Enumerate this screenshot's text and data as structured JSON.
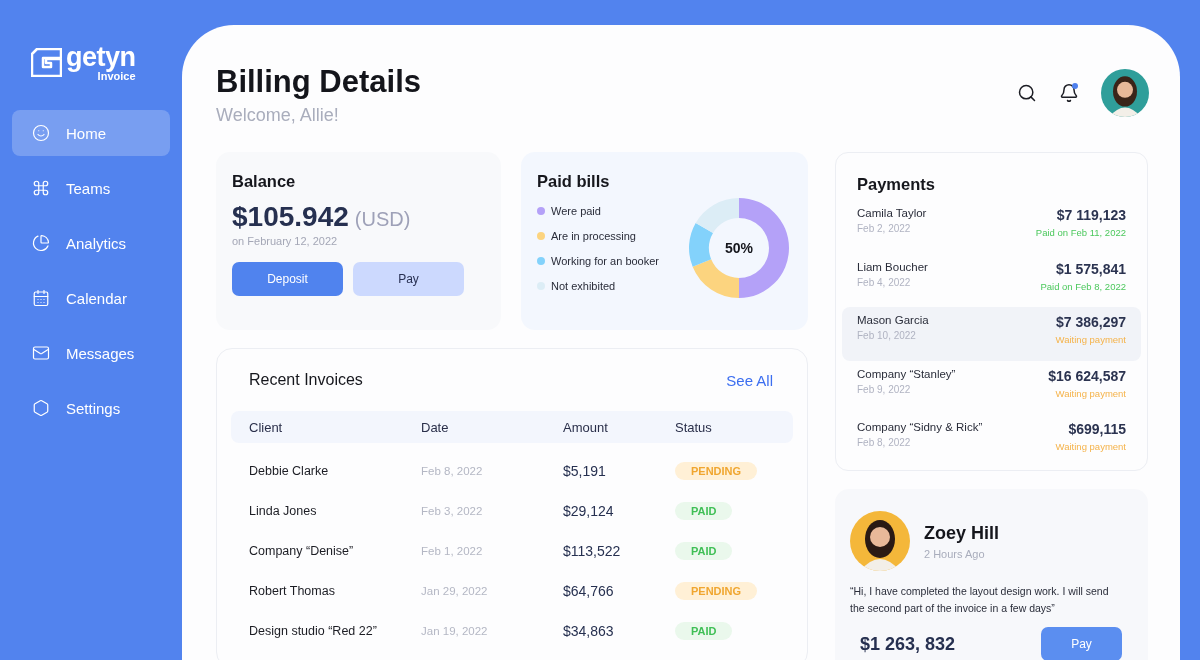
{
  "brand": {
    "name": "getyn",
    "sub": "Invoice"
  },
  "sidebar": {
    "items": [
      {
        "label": "Home",
        "selected": true
      },
      {
        "label": "Teams",
        "selected": false
      },
      {
        "label": "Analytics",
        "selected": false
      },
      {
        "label": "Calendar",
        "selected": false
      },
      {
        "label": "Messages",
        "selected": false
      },
      {
        "label": "Settings",
        "selected": false
      }
    ]
  },
  "header": {
    "title": "Billing Details",
    "subtitle": "Welcome, Allie!",
    "notification_badge": true
  },
  "balance": {
    "title": "Balance",
    "amount": "$105.942",
    "currency": "(USD)",
    "date": "on February 12, 2022",
    "buttons": [
      {
        "label": "Deposit",
        "kind": "primary"
      },
      {
        "label": "Pay",
        "kind": "secondary"
      }
    ]
  },
  "paid_bills": {
    "title": "Paid bills",
    "center_label": "50%",
    "legend": [
      {
        "label": "Were paid",
        "color": "#b4a1f8"
      },
      {
        "label": "Are in processing",
        "color": "#fcd47f"
      },
      {
        "label": "Working for an booker",
        "color": "#83d2fb"
      },
      {
        "label": "Not exhibited",
        "color": "#dcedf6"
      }
    ]
  },
  "invoices": {
    "title": "Recent Invoices",
    "link": "See All",
    "columns": [
      "Client",
      "Date",
      "Amount",
      "Status"
    ],
    "rows": [
      {
        "client": "Debbie Clarke",
        "date": "Feb 8, 2022",
        "amount": "$5,191",
        "status": "PENDING",
        "kind": "pending"
      },
      {
        "client": "Linda Jones",
        "date": "Feb 3, 2022",
        "amount": "$29,124",
        "status": "PAID",
        "kind": "paid"
      },
      {
        "client": "Company “Denise”",
        "date": "Feb 1, 2022",
        "amount": "$113,522",
        "status": "PAID",
        "kind": "paid"
      },
      {
        "client": "Robert Thomas",
        "date": "Jan 29, 2022",
        "amount": "$64,766",
        "status": "PENDING",
        "kind": "pending"
      },
      {
        "client": "Design studio “Red 22”",
        "date": "Jan 19, 2022",
        "amount": "$34,863",
        "status": "PAID",
        "kind": "paid"
      }
    ]
  },
  "payments": {
    "title": "Payments",
    "items": [
      {
        "name": "Camila Taylor",
        "date": "Feb 2, 2022",
        "amount": "$7 119,123",
        "status": "Paid on Feb 11, 2022",
        "kind": "paid",
        "selected": false
      },
      {
        "name": "Liam Boucher",
        "date": "Feb 4, 2022",
        "amount": "$1 575,841",
        "status": "Paid on Feb 8, 2022",
        "kind": "paid",
        "selected": false
      },
      {
        "name": "Mason Garcia",
        "date": "Feb 10, 2022",
        "amount": "$7 386,297",
        "status": "Waiting payment",
        "kind": "waiting",
        "selected": true
      },
      {
        "name": "Company “Stanley”",
        "date": "Feb 9, 2022",
        "amount": "$16 624,587",
        "status": "Waiting payment",
        "kind": "waiting",
        "selected": false
      },
      {
        "name": "Company “Sidny & Rick”",
        "date": "Feb 8, 2022",
        "amount": "$699,115",
        "status": "Waiting payment",
        "kind": "waiting",
        "selected": false
      }
    ]
  },
  "message": {
    "name": "Zoey Hill",
    "time": "2 Hours Ago",
    "text": "“Hi, I have completed the layout design work. I will send the second part of the invoice in a few days”",
    "amount": "$1 263, 832",
    "button": "Pay"
  }
}
